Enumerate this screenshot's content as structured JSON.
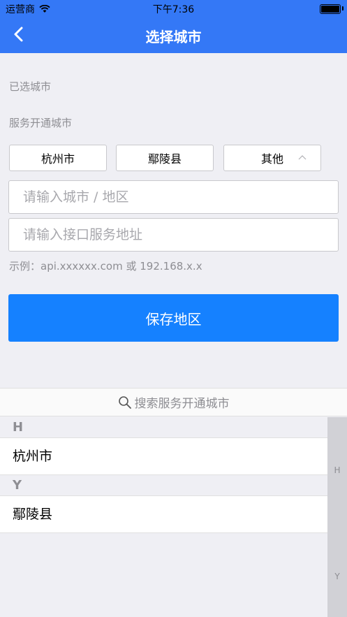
{
  "status_bar": {
    "carrier": "运营商",
    "time": "下午7:36"
  },
  "nav": {
    "title": "选择城市"
  },
  "selected_city_label": "已选城市",
  "service_cities_label": "服务开通城市",
  "city_buttons": [
    "杭州市",
    "鄢陵县",
    "其他"
  ],
  "inputs": {
    "city_placeholder": "请输入城市 / 地区",
    "api_placeholder": "请输入接口服务地址"
  },
  "example_text": "示例：api.xxxxxx.com 或 192.168.x.x",
  "save_label": "保存地区",
  "search_placeholder": "搜索服务开通城市",
  "sections": [
    {
      "letter": "H",
      "cities": [
        "杭州市"
      ]
    },
    {
      "letter": "Y",
      "cities": [
        "鄢陵县"
      ]
    }
  ],
  "index_letters": [
    "H",
    "Y"
  ],
  "colors": {
    "nav": "#3478f6",
    "accent": "#1581ff",
    "background": "#efeff4"
  }
}
